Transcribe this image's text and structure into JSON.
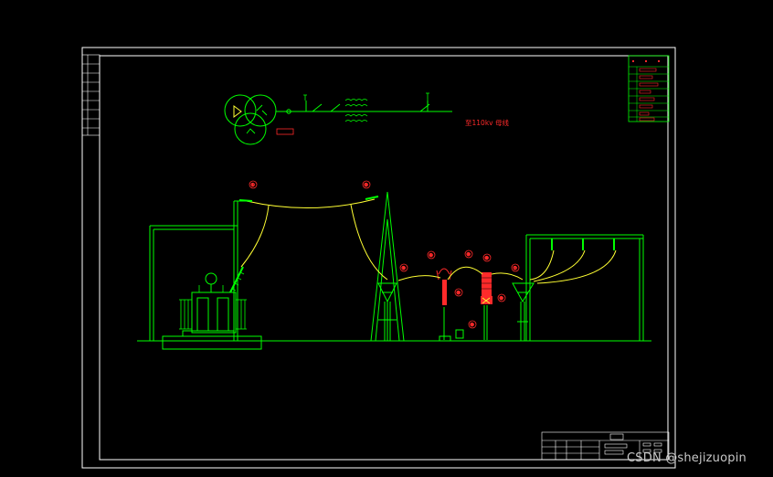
{
  "drawing": {
    "caption": "至110kv 母线",
    "callouts": [
      "①",
      "②",
      "③",
      "④",
      "⑤",
      "⑥",
      "⑦",
      "⑧",
      "⑨",
      "⑩"
    ]
  },
  "watermark": "CSDN @shejizuopin",
  "colors": {
    "background": "#000000",
    "frame": "#ffffff",
    "equipment": "#00ff00",
    "conductor": "#ffff33",
    "annotation": "#ff2a2a"
  }
}
